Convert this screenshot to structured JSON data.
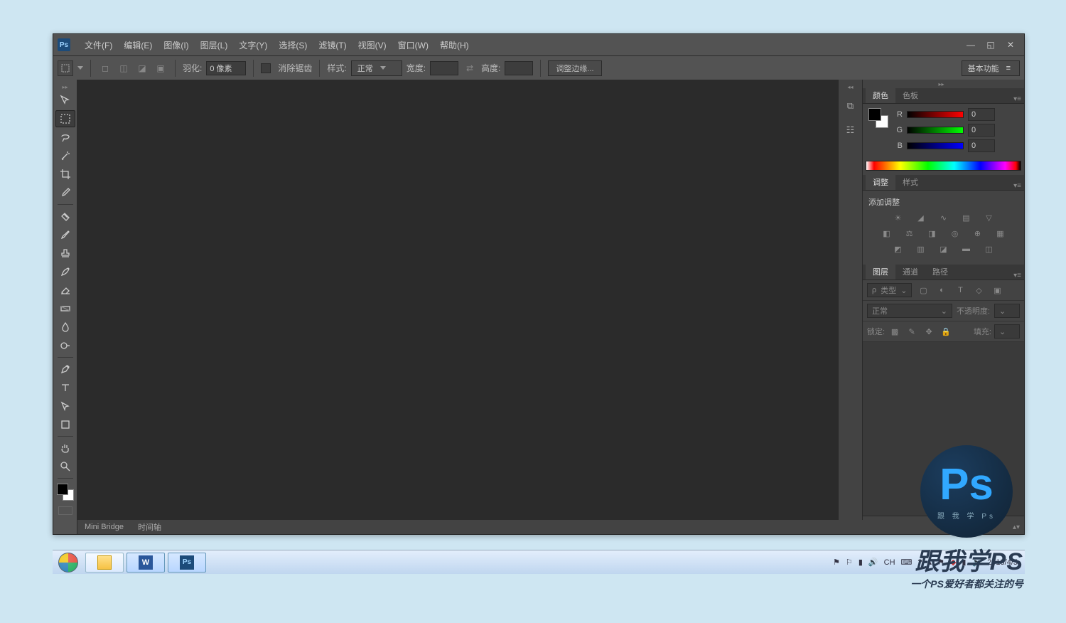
{
  "app": {
    "logo": "Ps"
  },
  "menu": [
    "文件(F)",
    "编辑(E)",
    "图像(I)",
    "图层(L)",
    "文字(Y)",
    "选择(S)",
    "滤镜(T)",
    "视图(V)",
    "窗口(W)",
    "帮助(H)"
  ],
  "options": {
    "feather_label": "羽化:",
    "feather_value": "0 像素",
    "antialias": "消除锯齿",
    "style_label": "样式:",
    "style_value": "正常",
    "width_label": "宽度:",
    "height_label": "高度:",
    "refine": "调整边缘...",
    "workspace": "基本功能"
  },
  "bottom_tabs": [
    "Mini Bridge",
    "时间轴"
  ],
  "panels": {
    "color": {
      "tabs": [
        "颜色",
        "色板"
      ],
      "r_label": "R",
      "g_label": "G",
      "b_label": "B",
      "r": "0",
      "g": "0",
      "b": "0"
    },
    "adjust": {
      "tabs": [
        "调整",
        "样式"
      ],
      "title": "添加调整"
    },
    "layers": {
      "tabs": [
        "图层",
        "通道",
        "路径"
      ],
      "filter_label": "类型",
      "blend": "正常",
      "opacity_label": "不透明度:",
      "lock_label": "锁定:",
      "fill_label": "填充:"
    }
  },
  "tools": [
    "move",
    "marquee",
    "lasso",
    "wand",
    "crop",
    "eyedrop",
    "heal",
    "brush",
    "stamp",
    "history",
    "eraser",
    "gradient",
    "blur",
    "dodge",
    "pen",
    "type",
    "path",
    "shape",
    "hand",
    "zoom"
  ],
  "taskbar": {
    "ime": "CH",
    "date": "2018/4/5"
  },
  "watermark": {
    "title": "跟我学PS",
    "sub": "一个PS爱好者都关注的号"
  },
  "badge": {
    "logo": "Ps",
    "text": "跟 我 学 Ps"
  }
}
